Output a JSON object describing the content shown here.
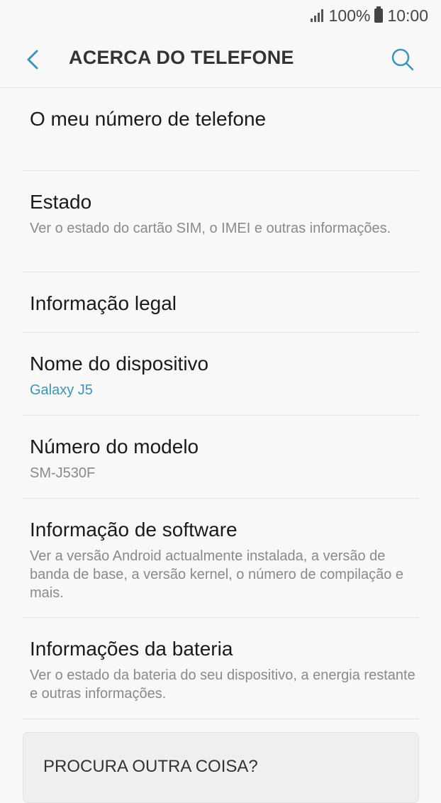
{
  "status": {
    "battery": "100%",
    "time": "10:00",
    "icons": [
      "signal-icon",
      "battery-icon"
    ]
  },
  "header": {
    "title": "ACERCA DO TELEFONE",
    "accent_color": "#3e93b6"
  },
  "items": [
    {
      "title": "O meu número de telefone",
      "subtitle": ""
    },
    {
      "title": "Estado",
      "subtitle": "Ver o estado do cartão SIM, o IMEI e outras informações."
    },
    {
      "title": "Informação legal",
      "subtitle": ""
    },
    {
      "title": "Nome do dispositivo",
      "subtitle": "Galaxy J5"
    },
    {
      "title": "Número do modelo",
      "subtitle": "SM-J530F"
    },
    {
      "title": "Informação de software",
      "subtitle": "Ver a versão Android actualmente instalada, a versão de banda de base, a versão kernel, o número de compilação e mais."
    },
    {
      "title": "Informações da bateria",
      "subtitle": "Ver o estado da bateria do seu dispositivo, a energia restante e outras informações."
    }
  ],
  "card": {
    "title": "PROCURA OUTRA COISA?"
  }
}
